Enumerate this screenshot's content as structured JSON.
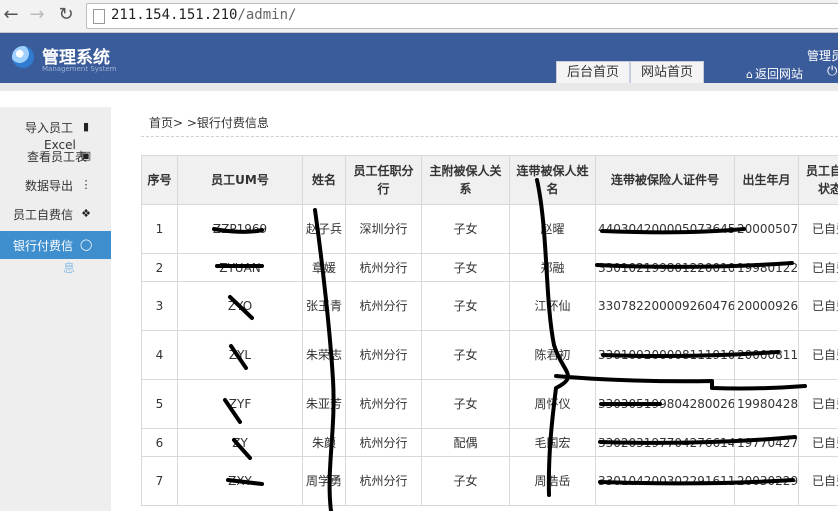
{
  "browser": {
    "url_host": "211.154.151.210",
    "url_path": "/admin/"
  },
  "header": {
    "title": "管理系统",
    "subtitle": "Management System",
    "user_text": "管理员",
    "tabs": [
      "后台首页",
      "网站首页"
    ],
    "home_link": "返回网站"
  },
  "sidebar": {
    "items": [
      {
        "label": "导入员工",
        "overflow": "Excel",
        "icon": "doc-icon"
      },
      {
        "label": "查看员工表",
        "icon": "car-icon"
      },
      {
        "label": "数据导出",
        "icon": "bars-icon"
      },
      {
        "label": "员工自费信",
        "icon": "tag-icon"
      },
      {
        "label": "银行付费信",
        "overflow": "息",
        "icon": "comment-icon",
        "active": true
      }
    ]
  },
  "breadcrumb": "首页> >银行付费信息",
  "table": {
    "headers": [
      "序号",
      "员工UM号",
      "姓名",
      "员工任职分行",
      "主附被保人关系",
      "连带被保人姓名",
      "连带被保险人证件号",
      "出生年月",
      "员工自费状态"
    ],
    "rows": [
      [
        "1",
        "ZZP1969",
        "赵子兵",
        "深圳分行",
        "子女",
        "赵曜",
        "440304200005073645",
        "20000507",
        "已自费"
      ],
      [
        "2",
        "ZYUAN",
        "章媛",
        "杭州分行",
        "子女",
        "郑融",
        "330102199801220010",
        "19980122",
        "已自费"
      ],
      [
        "3",
        "ZYO",
        "张玉青",
        "杭州分行",
        "子女",
        "江怀仙",
        "330782200009260476",
        "20000926",
        "已自费"
      ],
      [
        "4",
        "ZYL",
        "朱荣志",
        "杭州分行",
        "子女",
        "陈君初",
        "330109200008111910",
        "20000811",
        "已自费"
      ],
      [
        "5",
        "ZYF",
        "朱亚芳",
        "杭州分行",
        "子女",
        "周怀仪",
        "330305199804280026",
        "19980428",
        "已自费"
      ],
      [
        "6",
        "ZY",
        "朱颜",
        "杭州分行",
        "配偶",
        "毛国宏",
        "330203197704276614",
        "19770427",
        "已自费"
      ],
      [
        "7",
        "ZXY",
        "周学勇",
        "杭州分行",
        "子女",
        "周浩岳",
        "330104200302291611",
        "20030229",
        "已自费"
      ]
    ]
  }
}
